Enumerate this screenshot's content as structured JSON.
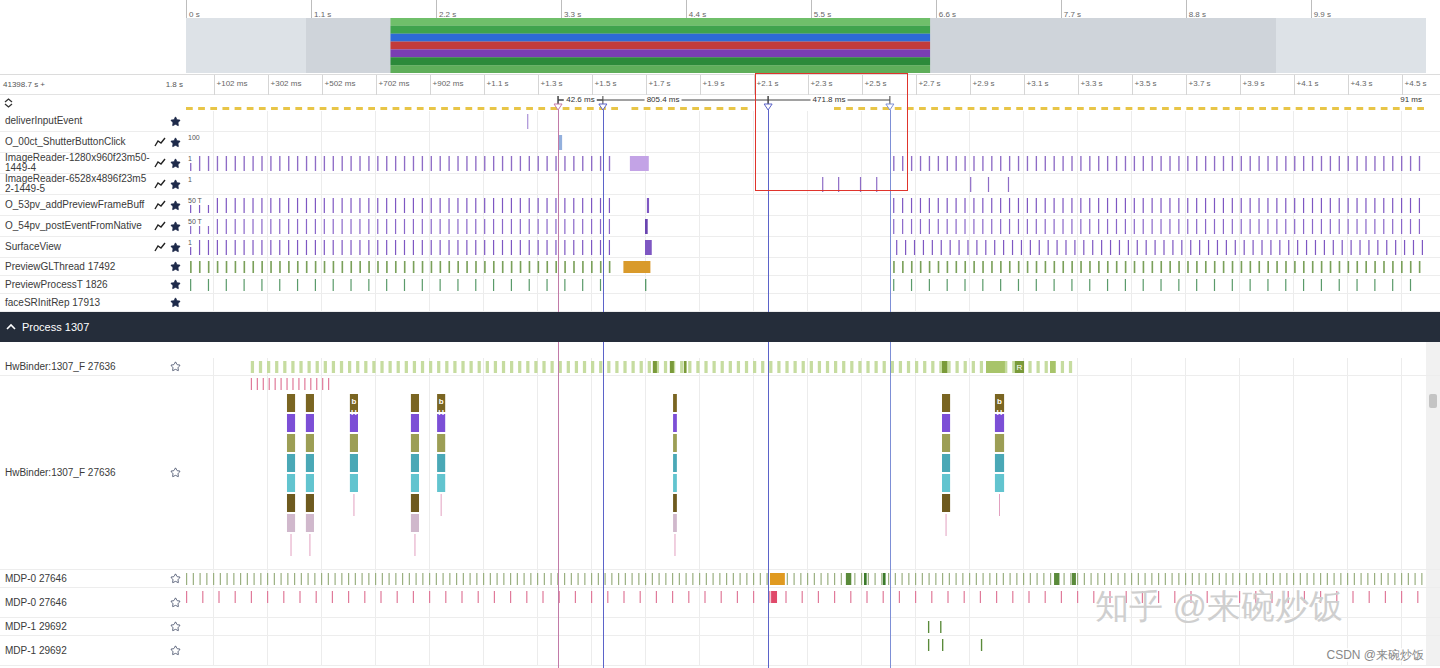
{
  "overview": {
    "ticks": [
      {
        "label": "0 s",
        "s": 0
      },
      {
        "label": "1.1 s",
        "s": 1.1
      },
      {
        "label": "2.2 s",
        "s": 2.2
      },
      {
        "label": "3.3 s",
        "s": 3.3
      },
      {
        "label": "4.4 s",
        "s": 4.4
      },
      {
        "label": "5.5 s",
        "s": 5.5
      },
      {
        "label": "6.6 s",
        "s": 6.6
      },
      {
        "label": "7.7 s",
        "s": 7.7
      },
      {
        "label": "8.8 s",
        "s": 8.8
      },
      {
        "label": "9.9 s",
        "s": 9.9
      }
    ],
    "highlight": {
      "from_s": 1.8,
      "to_s": 6.55
    },
    "stripes": [
      "#6fbf6a",
      "#3fa34d",
      "#2d6bd6",
      "#c23b3b",
      "#7a3db3",
      "#2c8a3a",
      "#5fae5a"
    ]
  },
  "ruler": {
    "origin": "41398.7 s +",
    "span": "1.8 s",
    "scale": "91 ms",
    "ticks": [
      {
        "ms": 102,
        "label": "+102 ms"
      },
      {
        "ms": 302,
        "label": "+302 ms"
      },
      {
        "ms": 502,
        "label": "+502 ms"
      },
      {
        "ms": 702,
        "label": "+702 ms"
      },
      {
        "ms": 902,
        "label": "+902 ms"
      },
      {
        "ms": 1102,
        "label": "+1.1 s"
      },
      {
        "ms": 1302,
        "label": "+1.3 s"
      },
      {
        "ms": 1502,
        "label": "+1.5 s"
      },
      {
        "ms": 1702,
        "label": "+1.7 s"
      },
      {
        "ms": 1902,
        "label": "+1.9 s"
      },
      {
        "ms": 2102,
        "label": "+2.1 s"
      },
      {
        "ms": 2302,
        "label": "+2.3 s"
      },
      {
        "ms": 2502,
        "label": "+2.5 s"
      },
      {
        "ms": 2702,
        "label": "+2.7 s"
      },
      {
        "ms": 2902,
        "label": "+2.9 s"
      },
      {
        "ms": 3102,
        "label": "+3.1 s"
      },
      {
        "ms": 3302,
        "label": "+3.3 s"
      },
      {
        "ms": 3502,
        "label": "+3.5 s"
      },
      {
        "ms": 3702,
        "label": "+3.7 s"
      },
      {
        "ms": 3902,
        "label": "+3.9 s"
      },
      {
        "ms": 4102,
        "label": "+4.1 s"
      },
      {
        "ms": 4302,
        "label": "+4.3 s"
      },
      {
        "ms": 4502,
        "label": "+4.5 s"
      }
    ]
  },
  "markers": [
    {
      "ms": 1378,
      "color": "#c27aa8"
    },
    {
      "ms": 1544,
      "color": "#5b63c9"
    },
    {
      "ms": 2156,
      "color": "#5b63c9"
    },
    {
      "ms": 2607,
      "color": "#7d8fd6"
    }
  ],
  "measurements": [
    {
      "from_ms": 1378,
      "to_ms": 2156,
      "label": "805.4 ms"
    },
    {
      "from_ms": 1378,
      "to_ms": 1544,
      "label": "42.6 ms"
    },
    {
      "from_ms": 2156,
      "to_ms": 2607,
      "label": "471.8 ms"
    }
  ],
  "selection": {
    "from_ms": 2107,
    "to_ms": 2674,
    "color": "#e0342c"
  },
  "dashes": {
    "color": "#e8c547",
    "every": 45,
    "dur": 25,
    "ranges": [
      {
        "from": 0,
        "to": 1580
      },
      {
        "from": 1650,
        "to": 2090
      },
      {
        "from": 2400,
        "to": 4593
      }
    ]
  },
  "tracks": [
    {
      "name": "deliverInputEvent",
      "kind": "counter",
      "graph": false,
      "pinned": true,
      "slices": [
        {
          "ms": 1263,
          "dur": 5,
          "color": "#b39ddb"
        }
      ]
    },
    {
      "name": "O_00ct_ShutterButtonClick",
      "kind": "counter",
      "graph": true,
      "pinned": true,
      "scale": "100",
      "slices": [
        {
          "ms": 1378,
          "dur": 15,
          "color": "#93b0dd"
        }
      ]
    },
    {
      "name": "ImageReader-1280x960f23m50-1449-4",
      "kind": "counter",
      "graph": true,
      "pinned": true,
      "scale": "1",
      "runs": [
        {
          "from": 15,
          "to": 1578,
          "every": 33,
          "dur": 5,
          "color": "#8e6cc6"
        },
        {
          "from": 2619,
          "to": 4589,
          "every": 33,
          "dur": 5,
          "color": "#8e6cc6"
        }
      ],
      "slices": [
        {
          "ms": 1644,
          "dur": 70,
          "color": "#c3a3e6"
        }
      ]
    },
    {
      "name": "ImageReader-6528x4896f23m52-1449-5",
      "kind": "counter",
      "graph": true,
      "pinned": true,
      "scale": "1",
      "slices": [
        {
          "ms": 2356,
          "dur": 4,
          "color": "#8e6cc6"
        },
        {
          "ms": 2415,
          "dur": 4,
          "color": "#8e6cc6"
        },
        {
          "ms": 2496,
          "dur": 4,
          "color": "#8e6cc6"
        },
        {
          "ms": 2556,
          "dur": 4,
          "color": "#8e6cc6"
        },
        {
          "ms": 2904,
          "dur": 4,
          "color": "#8e6cc6"
        },
        {
          "ms": 2970,
          "dur": 4,
          "color": "#8e6cc6"
        },
        {
          "ms": 3044,
          "dur": 4,
          "color": "#8e6cc6"
        }
      ]
    },
    {
      "name": "O_53pv_addPreviewFrameBuff",
      "kind": "counter",
      "graph": true,
      "pinned": true,
      "scale": "50 T",
      "runs": [
        {
          "from": 15,
          "to": 1585,
          "every": 33,
          "dur": 4,
          "color": "#7e57c2"
        },
        {
          "from": 2619,
          "to": 4589,
          "every": 33,
          "dur": 4,
          "color": "#7e57c2"
        }
      ],
      "slices": [
        {
          "ms": 1707,
          "dur": 8,
          "color": "#7e57c2"
        }
      ]
    },
    {
      "name": "O_54pv_postEventFromNative",
      "kind": "counter",
      "graph": true,
      "pinned": true,
      "scale": "50 T",
      "runs": [
        {
          "from": 15,
          "to": 1585,
          "every": 33,
          "dur": 4,
          "color": "#8a67c9"
        },
        {
          "from": 2619,
          "to": 4589,
          "every": 33,
          "dur": 4,
          "color": "#8a67c9"
        }
      ],
      "slices": [
        {
          "ms": 1700,
          "dur": 10,
          "color": "#6a45b0"
        }
      ]
    },
    {
      "name": "SurfaceView",
      "kind": "counter",
      "graph": true,
      "pinned": true,
      "scale": "1",
      "runs": [
        {
          "from": 15,
          "to": 1578,
          "every": 33,
          "dur": 4,
          "color": "#7e57c2"
        },
        {
          "from": 2630,
          "to": 4589,
          "every": 33,
          "dur": 4,
          "color": "#7e57c2"
        }
      ],
      "slices": [
        {
          "ms": 1700,
          "dur": 25,
          "color": "#7e57c2"
        }
      ]
    },
    {
      "name": "PreviewGLThread 17492",
      "kind": "thread",
      "graph": false,
      "pinned": true,
      "runs": [
        {
          "from": 15,
          "to": 1578,
          "every": 33,
          "dur": 6,
          "color": "#7aa05a"
        },
        {
          "from": 2619,
          "to": 4589,
          "every": 33,
          "dur": 6,
          "color": "#7aa05a"
        }
      ],
      "slices": [
        {
          "ms": 1620,
          "dur": 100,
          "color": "#d99a2b"
        }
      ]
    },
    {
      "name": "PreviewProcessT 1826",
      "kind": "thread",
      "graph": false,
      "pinned": true,
      "runs": [
        {
          "from": 15,
          "to": 1578,
          "every": 66,
          "dur": 4,
          "color": "#5a9a6a"
        },
        {
          "from": 2619,
          "to": 4589,
          "every": 66,
          "dur": 4,
          "color": "#5a9a6a"
        }
      ],
      "slices": [
        {
          "ms": 1700,
          "dur": 5,
          "color": "#5a9a6a"
        }
      ]
    },
    {
      "name": "faceSRInitRep 17913",
      "kind": "thread",
      "graph": false,
      "pinned": true
    }
  ],
  "process": {
    "title": "Process 1307",
    "expanded": true,
    "levels": [
      "#7a6522",
      "#7c4fd6",
      "#9c9e55",
      "#4aa8b6",
      "#62c4cf",
      "#6e5a1f",
      "#d0b8cc"
    ],
    "tracks": [
      {
        "name": "HwBinder:1307_F 27636",
        "kind": "thread",
        "graph": false,
        "pinned": false,
        "runs": [
          {
            "from": 240,
            "to": 3300,
            "every": 30,
            "dur": 12,
            "color": "#c6dca0"
          }
        ],
        "slices": [
          {
            "ms": 1729,
            "dur": 15,
            "color": "#7a9a3a"
          },
          {
            "ms": 1792,
            "dur": 15,
            "color": "#7a9a3a"
          },
          {
            "ms": 1844,
            "dur": 10,
            "color": "#7a9a3a"
          },
          {
            "ms": 2800,
            "dur": 20,
            "color": "#7a9a3a"
          },
          {
            "ms": 2963,
            "dur": 70,
            "color": "#a8c46a"
          },
          {
            "ms": 3070,
            "dur": 34,
            "color": "#7a9a3a",
            "label": "R"
          },
          {
            "ms": 3200,
            "dur": 20,
            "color": "#a8c46a"
          }
        ]
      },
      {
        "name": "HwBinder:1307_F 27636",
        "kind": "stack",
        "graph": false,
        "pinned": false,
        "runs": [
          {
            "from": 240,
            "to": 540,
            "every": 22,
            "dur": 3,
            "color": "#e07a9a"
          }
        ],
        "columns": [
          {
            "ms": 374,
            "dur": 30,
            "depth": 7
          },
          {
            "ms": 444,
            "dur": 30,
            "depth": 7
          },
          {
            "ms": 607,
            "dur": 30,
            "depth": 5,
            "labels": [
              "b",
              "H"
            ]
          },
          {
            "ms": 833,
            "dur": 30,
            "depth": 7
          },
          {
            "ms": 930,
            "dur": 30,
            "depth": 5,
            "labels": [
              "b",
              "H"
            ]
          },
          {
            "ms": 1804,
            "dur": 14,
            "depth": 7
          },
          {
            "ms": 2800,
            "dur": 30,
            "depth": 6
          },
          {
            "ms": 2996,
            "dur": 34,
            "depth": 5,
            "labels": [
              "b",
              "H"
            ]
          }
        ]
      },
      {
        "name": "MDP-0 27646",
        "kind": "thread",
        "graph": false,
        "pinned": false,
        "runs": [
          {
            "from": 0,
            "to": 4593,
            "every": 25,
            "dur": 4,
            "color": "#9ab080"
          }
        ],
        "slices": [
          {
            "ms": 2163,
            "dur": 55,
            "color": "#e09a20"
          },
          {
            "ms": 2444,
            "dur": 20,
            "color": "#5a8a3a"
          },
          {
            "ms": 2511,
            "dur": 10,
            "color": "#3a7a2a"
          },
          {
            "ms": 2581,
            "dur": 10,
            "color": "#3a7a2a"
          },
          {
            "ms": 3215,
            "dur": 20,
            "color": "#5a8a3a"
          },
          {
            "ms": 3281,
            "dur": 15,
            "color": "#5a8a3a"
          }
        ]
      },
      {
        "name": "MDP-0 27646",
        "kind": "tall",
        "graph": false,
        "pinned": false,
        "runs": [
          {
            "from": 0,
            "to": 4593,
            "every": 60,
            "dur": 4,
            "color": "#e07a9a"
          }
        ],
        "slices": [
          {
            "ms": 2167,
            "dur": 22,
            "color": "#e04a6a"
          }
        ]
      },
      {
        "name": "MDP-1 29692",
        "kind": "thread",
        "graph": false,
        "pinned": false,
        "slices": [
          {
            "ms": 2748,
            "dur": 5,
            "color": "#5a8a3a"
          },
          {
            "ms": 2793,
            "dur": 5,
            "color": "#5a8a3a"
          }
        ]
      },
      {
        "name": "MDP-1 29692",
        "kind": "tall",
        "graph": false,
        "pinned": false,
        "slices": [
          {
            "ms": 2748,
            "dur": 5,
            "color": "#5a8a3a"
          },
          {
            "ms": 2800,
            "dur": 5,
            "color": "#5a8a3a"
          },
          {
            "ms": 2944,
            "dur": 5,
            "color": "#5a8a3a"
          }
        ]
      }
    ]
  },
  "watermarks": [
    "知乎 @来碗炒饭",
    "CSDN @来碗炒饭"
  ]
}
